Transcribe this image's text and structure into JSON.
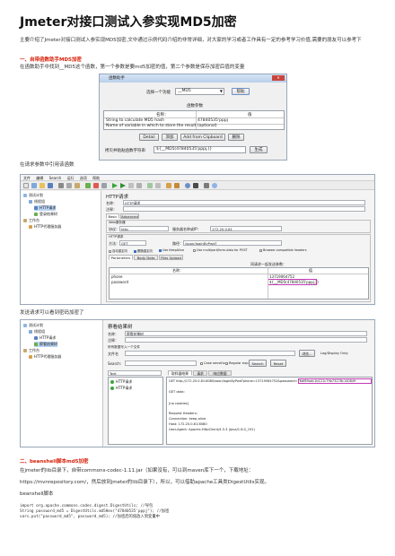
{
  "doc": {
    "title": "Jmeter对接口测试入参实现MD5加密",
    "intro": "主要介绍了Jmeter对接口测试入参实现MD5加密,文中通过示例代码介绍的非常详细，对大家的学习或者工作具有一定的参考学习价值,需要的朋友可以参考下",
    "section1_heading": "一、自带函数助手MD5加密",
    "section1_text": "在函数助手中找到__MD5这个函数，第一个参数是要md5加密的值，第二个参数是保存加密后值的变量",
    "after_shot1_text": "在请求参数中引用该函数",
    "after_shot2_text": "发送请求可以看到密码加密了",
    "section2_heading": "二、beanshell脚本md5加密",
    "section2_p1": "在jmeter的lib目录下，自带commons-codec-1.11.jar（如果没有，可以到maven库下一个，下载地址：",
    "section2_p2": "https://mvnrepository.com/，然后放到jmeter的lib目录下），所以，可以借助apache工具类DigestUtils实现。",
    "section2_p3": "beanshell脚本",
    "code_lines": [
      "import org.apache.commons.codec.digest.DigestUtils; //导包",
      "String password_md5 = DigestUtils.md5Hex(\"47840535'pppj\"); //加密",
      "vars.put(\"password_md5\", password_md5); //加密后的值放入到变量中"
    ]
  },
  "dialog": {
    "title": "函数助手",
    "select_label": "选择一个功能",
    "select_value": "__MD5",
    "help_button": "帮助",
    "params_label": "函数参数",
    "col_name": "名称：",
    "col_value": "值",
    "row1_name": "String to calculate MD5 hash",
    "row1_value": "47840535'pppj",
    "row2_name": "Name of variable in which to store the result (optional)",
    "buttons": [
      "Detail",
      "添加",
      "Add from Clipboard",
      "删除"
    ],
    "result_label": "拷贝并粘贴函数字符串",
    "result_value": "${__MD5(47840535'pppj,)}",
    "generate_button": "生成"
  },
  "jmeter": {
    "menus": [
      "文件",
      "编辑",
      "Search",
      "运行",
      "选项",
      "帮助"
    ],
    "tree": [
      "测试计划",
      "线程组",
      "HTTP请求",
      "登录结果树",
      "工作台",
      "HTTP代理服务器"
    ],
    "panel_title": "HTTP请求",
    "name_label": "名称：",
    "name_value": "HTTP请求",
    "comment_label": "注释：",
    "tabs": [
      "Basic",
      "Advanced"
    ],
    "web_server": "Web服务器",
    "protocol_label": "协议：",
    "protocol_value": "http",
    "server_label": "服务器名称或IP：",
    "server_value": "172.20.0.81",
    "http_request": "HTTP请求",
    "method_label": "方法：",
    "method_value": "GET",
    "path_label": "路径：",
    "path_value": "/soon/loginByPwd?",
    "options": [
      "自动重定向",
      "跟随重定向",
      "Use KeepAlive",
      "Use multipart/form-data for POST",
      "Browser-compatible headers"
    ],
    "subtabs": [
      "Parameters",
      "Body Data",
      "Files Upload"
    ],
    "send_params": "同请求一起发送参数：",
    "param_col_name": "名称：",
    "param_col_value": "值",
    "param_rows": [
      {
        "name": "phone",
        "value": "13719064752"
      },
      {
        "name": "password",
        "value": "${__MD5(47840535'pppj,)}"
      }
    ]
  },
  "results": {
    "tree": [
      "测试计划",
      "线程组",
      "HTTP请求",
      "察看结果树",
      "工作台",
      "HTTP代理服务器"
    ],
    "panel_title": "察看结果树",
    "name_label": "名称：",
    "name_value": "察看结果树",
    "comment_label": "注释：",
    "file_section": "所有数据写入一个文件",
    "file_label": "文件名",
    "browse_button": "浏览...",
    "log_label": "Log/Display Only:",
    "search_label": "Search:",
    "case_sensitive": "Case sensitive",
    "regex": "Regular exp.",
    "search_button": "Search",
    "reset_button": "Reset",
    "renderer": "Text",
    "result_tabs": [
      "取样器结果",
      "请求",
      "响应数据"
    ],
    "samples": [
      "HTTP请求",
      "HTTP请求"
    ],
    "request_line": "GET http://172.20.0.81:8080/soon/loginByPwd?phone=13719064752&password=76df89adc1b121c79b73278c140849",
    "lines": [
      "GET data:",
      "",
      "[no cookies]",
      "",
      "Request Headers:",
      "Connection: keep-alive",
      "Host: 172.20.0.81:8080",
      "User-Agent: Apache-HttpClient/4.5.3 (Java/1.8.0_191)"
    ]
  }
}
